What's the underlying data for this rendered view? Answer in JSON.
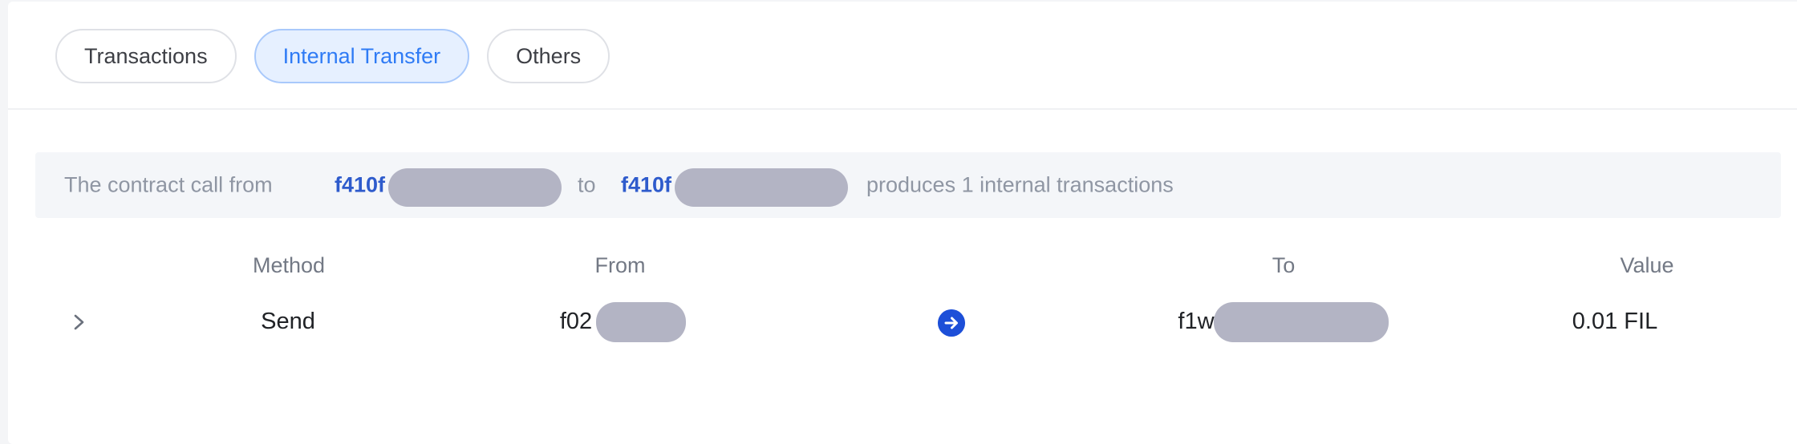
{
  "tabs": [
    {
      "label": "Transactions",
      "active": false
    },
    {
      "label": "Internal Transfer",
      "active": true
    },
    {
      "label": "Others",
      "active": false
    }
  ],
  "notice": {
    "prefix": "The contract call from",
    "from_addr": "f410f",
    "connector": "to",
    "to_addr": "f410f",
    "suffix": "produces 1 internal transactions"
  },
  "table": {
    "headers": {
      "method": "Method",
      "from": "From",
      "to": "To",
      "value": "Value"
    },
    "rows": [
      {
        "method": "Send",
        "from": "f02",
        "to": "f1w",
        "value": "0.01 FIL"
      }
    ]
  },
  "icons": {
    "expand": "chevron-right-icon",
    "transfer": "arrow-right-circle-icon"
  },
  "colors": {
    "accent": "#2f7bf5",
    "address": "#2e5bcc",
    "transfer_icon": "#1d4fd8",
    "redaction": "#b3b4c4"
  }
}
